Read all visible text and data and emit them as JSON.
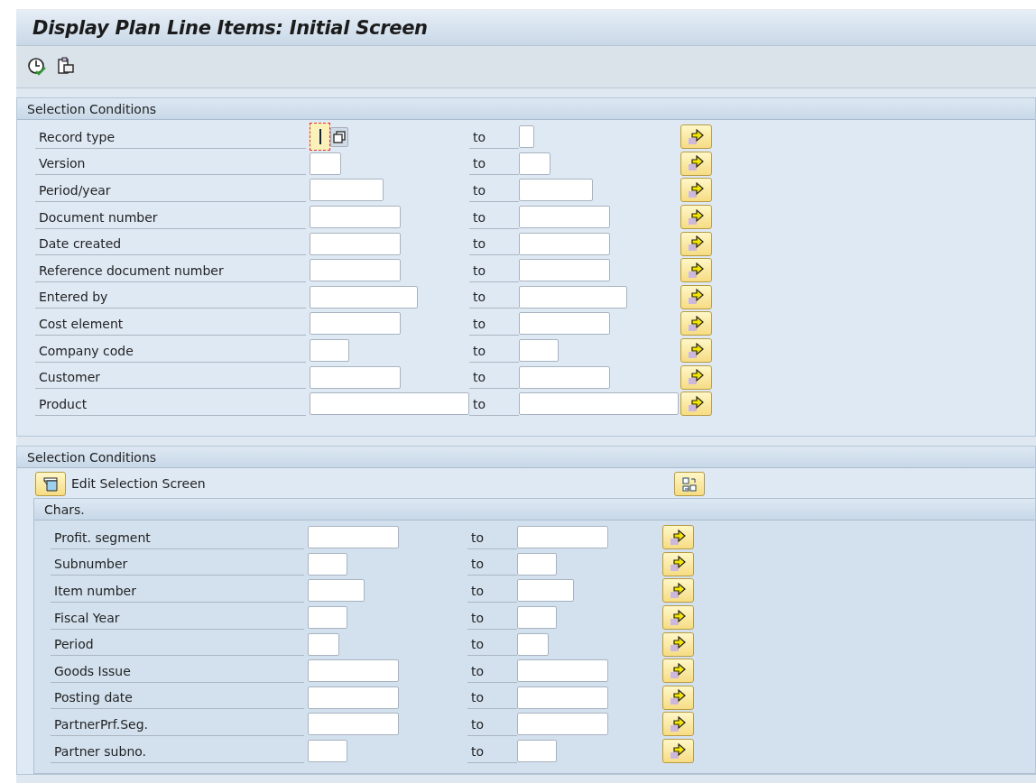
{
  "window": {
    "title": "Display Plan Line Items: Initial Screen"
  },
  "toolbar": [
    {
      "kind": "execute"
    },
    {
      "kind": "copy"
    }
  ],
  "sections": [
    {
      "title": "Selection Conditions",
      "rows": [
        {
          "label": "Record type",
          "to": "to",
          "focused": true
        },
        {
          "label": "Version",
          "to": "to",
          "focused": false
        },
        {
          "label": "Period/year",
          "to": "to",
          "focused": false
        },
        {
          "label": "Document number",
          "to": "to",
          "focused": false
        },
        {
          "label": "Date created",
          "to": "to",
          "focused": false
        },
        {
          "label": "Reference document number",
          "to": "to",
          "focused": false
        },
        {
          "label": "Entered by",
          "to": "to",
          "focused": false
        },
        {
          "label": "Cost element",
          "to": "to",
          "focused": false
        },
        {
          "label": "Company code",
          "to": "to",
          "focused": false
        },
        {
          "label": "Customer",
          "to": "to",
          "focused": false
        },
        {
          "label": "Product",
          "to": "to",
          "focused": false
        }
      ]
    },
    {
      "title": "Selection Conditions",
      "edit_button": "Edit Selection Screen",
      "group": {
        "title": "Chars.",
        "rows": [
          {
            "label": "Profit. segment",
            "to": "to",
            "focused": false
          },
          {
            "label": "Subnumber",
            "to": "to",
            "focused": false
          },
          {
            "label": "Item number",
            "to": "to",
            "focused": false
          },
          {
            "label": "Fiscal Year",
            "to": "to",
            "focused": false
          },
          {
            "label": "Period",
            "to": "to",
            "focused": false
          },
          {
            "label": "Goods Issue",
            "to": "to",
            "focused": false
          },
          {
            "label": "Posting date",
            "to": "to",
            "focused": false
          },
          {
            "label": "PartnerPrf.Seg.",
            "to": "to",
            "focused": false
          },
          {
            "label": "Partner subno.",
            "to": "to",
            "focused": false
          }
        ]
      }
    }
  ]
}
